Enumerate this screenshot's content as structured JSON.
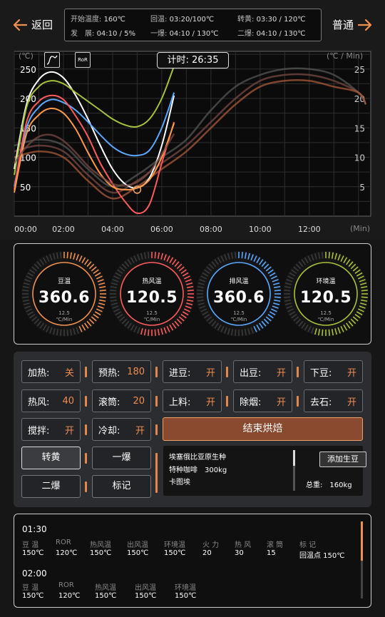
{
  "header": {
    "back_label": "返回",
    "mode_label": "普通",
    "info": [
      {
        "key": "开始温度:",
        "value": "160℃"
      },
      {
        "key": "回温:",
        "value": "03:20/100℃"
      },
      {
        "key": "转黄:",
        "value": "03:30 / 120℃"
      },
      {
        "key": "发　展:",
        "value": "04:10 / 5%"
      },
      {
        "key": "一爆:",
        "value": "04:10 / 130℃"
      },
      {
        "key": "二爆:",
        "value": "04:10 / 130℃"
      }
    ]
  },
  "chart": {
    "timer_label": "计时: 26:35",
    "left_unit": "(℃)",
    "right_unit": "(℃ / Min)",
    "x_unit": "(Min)",
    "ror_button": "RoR",
    "curve_icon": "curve-icon"
  },
  "chart_data": {
    "type": "line",
    "x_ticks": [
      "00:00",
      "02:00",
      "04:00",
      "06:00",
      "08:00",
      "10:00",
      "12:00"
    ],
    "y_left_ticks": [
      250,
      200,
      150,
      100,
      50
    ],
    "y_right_ticks": [
      25,
      20,
      15,
      10,
      5
    ],
    "ylim_left": [
      0,
      280
    ],
    "ylim_right": [
      0,
      28
    ],
    "xlim_minutes": [
      0,
      14.5
    ],
    "grid": true,
    "turning_point_marker": {
      "x": 5.0,
      "y": 45
    },
    "series": [
      {
        "color": "#ffffff",
        "axis": "left",
        "x": [
          0,
          0.5,
          1,
          1.5,
          2,
          2.5,
          3,
          3.5,
          4,
          4.5,
          5,
          5.5,
          6,
          6.5
        ],
        "y": [
          80,
          190,
          232,
          245,
          235,
          205,
          165,
          120,
          80,
          55,
          48,
          65,
          120,
          205
        ]
      },
      {
        "color": "#a6c23a",
        "axis": "left",
        "x": [
          0,
          0.5,
          1,
          1.5,
          2,
          2.5,
          3,
          3.5,
          4,
          4.5,
          5,
          5.5,
          6,
          6.5
        ],
        "y": [
          70,
          185,
          220,
          230,
          225,
          210,
          195,
          180,
          165,
          155,
          152,
          165,
          200,
          255
        ]
      },
      {
        "color": "#5aa8ff",
        "axis": "left",
        "x": [
          0,
          0.5,
          1,
          1.5,
          2,
          2.5,
          3,
          3.5,
          4,
          4.5,
          5,
          5.5,
          6,
          6.5
        ],
        "y": [
          50,
          150,
          185,
          198,
          193,
          180,
          160,
          138,
          118,
          106,
          103,
          112,
          150,
          210
        ]
      },
      {
        "color": "#ff5b5b",
        "axis": "left",
        "x": [
          0,
          0.5,
          1,
          1.5,
          2,
          2.5,
          3,
          3.5,
          4,
          4.5,
          5,
          5.5,
          6,
          6.5
        ],
        "y": [
          45,
          160,
          195,
          205,
          198,
          170,
          135,
          90,
          55,
          25,
          5,
          20,
          90,
          160
        ]
      },
      {
        "color": "#ff9a48",
        "axis": "left",
        "x": [
          0,
          0.5,
          1,
          1.5,
          2,
          2.5,
          3,
          3.5,
          4,
          4.5,
          5,
          5.5,
          6,
          6.5
        ],
        "y": [
          40,
          140,
          172,
          183,
          175,
          148,
          108,
          72,
          50,
          45,
          48,
          62,
          100,
          158
        ]
      },
      {
        "color": "#7a4a44",
        "axis": "left",
        "x": [
          0,
          0.5,
          1,
          1.5,
          2,
          2.5,
          3,
          3.5,
          4,
          4.5,
          5,
          5.5,
          6,
          6.5
        ],
        "y": [
          90,
          118,
          135,
          138,
          128,
          108,
          85,
          68,
          55,
          52,
          58,
          75,
          105,
          140
        ]
      },
      {
        "color": "#555555",
        "axis": "right",
        "x": [
          0,
          1,
          2,
          3,
          4,
          5,
          6,
          7,
          8,
          9,
          10,
          11,
          12,
          13,
          14,
          14.3
        ],
        "y": [
          12,
          13,
          12,
          8,
          5,
          7,
          10,
          13,
          18,
          22,
          24,
          25,
          25,
          24,
          21,
          19
        ]
      },
      {
        "color": "#7a4a44",
        "axis": "right",
        "x": [
          0,
          1,
          2,
          3,
          4,
          5,
          6,
          7,
          8,
          9,
          10,
          11,
          12,
          13,
          14,
          14.3
        ],
        "y": [
          11,
          12,
          11,
          7,
          4,
          6,
          9,
          12,
          16,
          20,
          23,
          24,
          24,
          23,
          21,
          19
        ]
      },
      {
        "color": "#a85a3a",
        "axis": "right",
        "x": [
          0,
          1,
          2,
          3,
          4,
          5,
          6,
          7,
          8,
          9,
          10,
          11,
          12,
          13,
          14,
          14.3
        ],
        "y": [
          10,
          11,
          10,
          6,
          3,
          5,
          8,
          11,
          15,
          19,
          22,
          23,
          23,
          22,
          21,
          19
        ]
      }
    ]
  },
  "gauges": [
    {
      "label": "豆温",
      "value": "360.6",
      "rate": "12.5",
      "unit": "℃/Min",
      "color": "#f09050",
      "level": 0.45
    },
    {
      "label": "热风温",
      "value": "120.5",
      "rate": "12.5",
      "unit": "℃/Min",
      "color": "#ff5b5b",
      "level": 0.55
    },
    {
      "label": "排风温",
      "value": "360.6",
      "rate": "12.5",
      "unit": "℃/Min",
      "color": "#5aa8ff",
      "level": 0.45
    },
    {
      "label": "环境温",
      "value": "120.5",
      "rate": "12.5",
      "unit": "℃/Min",
      "color": "#a6c23a",
      "level": 0.55
    }
  ],
  "controls": {
    "rows": [
      [
        {
          "label": "加热:",
          "value": "关"
        },
        {
          "label": "预热:",
          "value": "180"
        },
        {
          "label": "进豆:",
          "value": "开"
        },
        {
          "label": "出豆:",
          "value": "开"
        },
        {
          "label": "下豆:",
          "value": "开"
        }
      ],
      [
        {
          "label": "热风:",
          "value": "40"
        },
        {
          "label": "滚筒:",
          "value": "20"
        },
        {
          "label": "上料:",
          "value": "开"
        },
        {
          "label": "除烟:",
          "value": "开"
        },
        {
          "label": "去石:",
          "value": "开"
        }
      ],
      [
        {
          "label": "搅拌:",
          "value": "开"
        },
        {
          "label": "冷却:",
          "value": "开"
        }
      ]
    ],
    "end_roast": "结束烘焙",
    "mode_buttons": [
      "转黄",
      "一爆",
      "二爆",
      "标记"
    ],
    "bean": {
      "name": "埃塞俄比亚原生种",
      "line2": "特种咖啡　300kg",
      "line3": "卡图埃",
      "add_label": "添加生豆",
      "total": "总重:　160kg"
    }
  },
  "log": {
    "entries": [
      {
        "time": "01:30",
        "headers": [
          "豆 温",
          "ROR",
          "热风温",
          "出风温",
          "环境温",
          "火 力",
          "热 风",
          "滚 筒",
          "标 记"
        ],
        "values": [
          "150℃",
          "120℃",
          "150℃",
          "150℃",
          "150℃",
          "20",
          "30",
          "15",
          "回温点 150℃"
        ]
      },
      {
        "time": "02:00",
        "headers": [
          "豆 温",
          "ROR",
          "热风温",
          "出风温",
          "环境温"
        ],
        "values": [
          "150℃",
          "120℃",
          "150℃",
          "150℃",
          "150℃"
        ]
      }
    ]
  }
}
